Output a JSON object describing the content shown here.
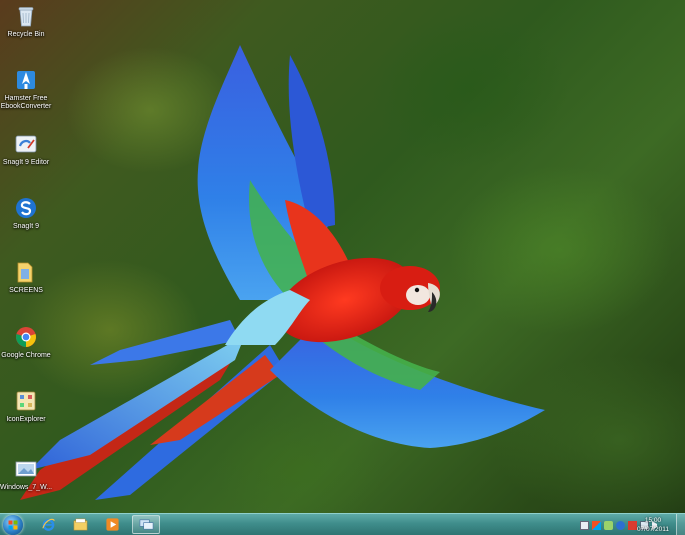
{
  "desktop": {
    "wallpaper": "scarlet-macaw-in-flight",
    "icons": [
      {
        "label": "Recycle Bin",
        "icon": "recycle-bin-icon"
      },
      {
        "label": "Hamster Free EbookConverter",
        "icon": "hamster-converter-icon"
      },
      {
        "label": "SnagIt 9 Editor",
        "icon": "snagit-editor-icon"
      },
      {
        "label": "SnagIt 9",
        "icon": "snagit-icon"
      },
      {
        "label": "SCREENS",
        "icon": "folder-icon"
      },
      {
        "label": "Google Chrome",
        "icon": "chrome-icon"
      },
      {
        "label": "IconExplorer",
        "icon": "icon-explorer-icon"
      },
      {
        "label": "Windows_7_W...",
        "icon": "image-file-icon"
      }
    ]
  },
  "taskbar": {
    "start": "windows-start-icon",
    "pinned": [
      "internet-explorer-icon",
      "windows-explorer-icon",
      "media-player-icon",
      "remote-desktop-icon"
    ],
    "clock_time": "15:00",
    "clock_date": "07/07/2011",
    "colors": {
      "bar": "#3f8d8b",
      "bar_light": "#5eaba8"
    }
  }
}
